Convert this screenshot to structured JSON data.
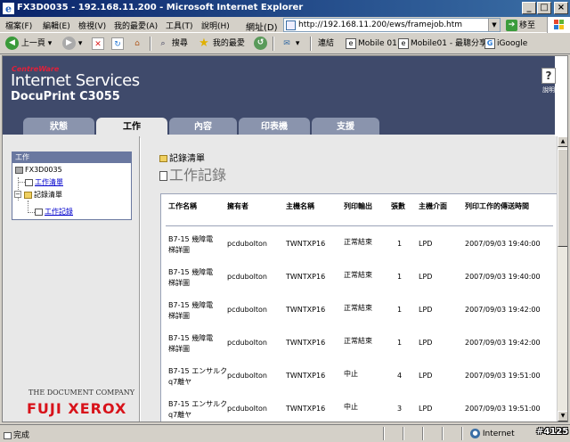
{
  "window": {
    "title": "FX3D0035 - 192.168.11.200 - Microsoft Internet Explorer"
  },
  "menu": {
    "items": [
      "檔案(F)",
      "編輯(E)",
      "檢視(V)",
      "我的最愛(A)",
      "工具(T)",
      "說明(H)"
    ]
  },
  "address": {
    "label": "網址(D)",
    "url": "http://192.168.11.200/ews/framejob.htm",
    "go_label": "移至"
  },
  "toolbar": {
    "back": "上一頁",
    "search": "搜尋",
    "favorites": "我的最愛",
    "links_label": "連結",
    "links": [
      "Mobile 01",
      "Mobile01 - 最聰分享",
      "iGoogle"
    ]
  },
  "brand": {
    "centreware": "CentreWare",
    "internet_services": "Internet Services",
    "product": "DocuPrint C3055",
    "help_label": "說明"
  },
  "tabs": [
    {
      "label": "狀態"
    },
    {
      "label": "工作"
    },
    {
      "label": "內容"
    },
    {
      "label": "印表機"
    },
    {
      "label": "支援"
    }
  ],
  "tree": {
    "header": "工作",
    "root": "FX3D0035",
    "job_list": "工作清單",
    "history_folder": "記錄清單",
    "job_history": "工作記錄"
  },
  "company": {
    "tagline": "THE DOCUMENT COMPANY",
    "name": "FUJI XEROX"
  },
  "main": {
    "breadcrumb": "記錄清單",
    "title": "工作記錄"
  },
  "table": {
    "headers": [
      "工作名稱",
      "擁有者",
      "主機名稱",
      "列印輸出",
      "張數",
      "主機介面",
      "列印工作的傳送時間"
    ],
    "rows": [
      {
        "name1": "B7-15 幾障電",
        "name2": "梯詳圖",
        "owner": "pcdubolton",
        "host": "TWNTXP16",
        "output": "正常結束",
        "count": "1",
        "iface": "LPD",
        "time": "2007/09/03 19:40:00"
      },
      {
        "name1": "B7-15 幾障電",
        "name2": "梯詳圖",
        "owner": "pcdubolton",
        "host": "TWNTXP16",
        "output": "正常結束",
        "count": "1",
        "iface": "LPD",
        "time": "2007/09/03 19:40:00"
      },
      {
        "name1": "B7-15 幾障電",
        "name2": "梯詳圖",
        "owner": "pcdubolton",
        "host": "TWNTXP16",
        "output": "正常結束",
        "count": "1",
        "iface": "LPD",
        "time": "2007/09/03 19:42:00"
      },
      {
        "name1": "B7-15 幾障電",
        "name2": "梯詳圖",
        "owner": "pcdubolton",
        "host": "TWNTXP16",
        "output": "正常結束",
        "count": "1",
        "iface": "LPD",
        "time": "2007/09/03 19:42:00"
      },
      {
        "name1": "B7-15 エンサルク",
        "name2": "q7離ヤ",
        "owner": "pcdubolton",
        "host": "TWNTXP16",
        "output": "中止",
        "count": "4",
        "iface": "LPD",
        "time": "2007/09/03 19:51:00"
      },
      {
        "name1": "B7-15 エンサルク",
        "name2": "q7離ヤ",
        "owner": "pcdubolton",
        "host": "TWNTXP16",
        "output": "中止",
        "count": "3",
        "iface": "LPD",
        "time": "2007/09/03 19:51:00"
      }
    ]
  },
  "status": {
    "text": "完成",
    "zone": "Internet"
  },
  "watermark": "#4125"
}
